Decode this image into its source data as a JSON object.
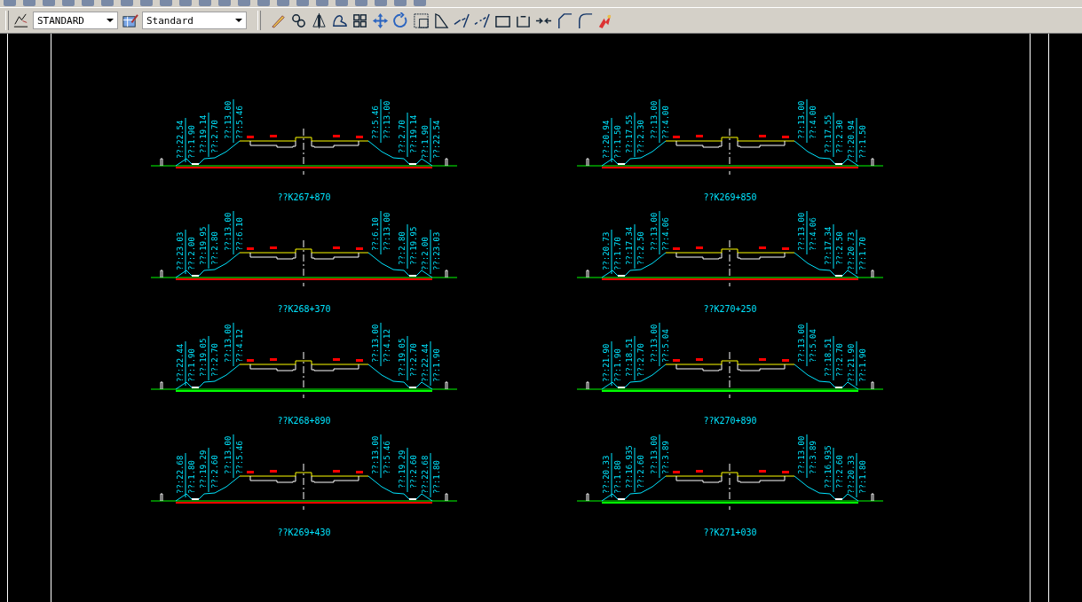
{
  "toolbar": {
    "dropdowns": [
      {
        "value": "STANDARD"
      },
      {
        "value": "Standard"
      }
    ]
  },
  "sections": [
    {
      "station": "??K267+870",
      "color": "#ff0000",
      "left": [
        [
          "??:22.54",
          "??:1.90"
        ],
        [
          "??:19.14",
          "??:2.70"
        ],
        [
          "??:13.00",
          "??:5.46"
        ]
      ],
      "right": [
        [
          "??:5.46",
          "??:13.00"
        ],
        [
          "??:2.70",
          "??:19.14"
        ],
        [
          "??:1.90",
          "??:22.54"
        ]
      ]
    },
    {
      "station": "??K269+850",
      "color": "#ff0000",
      "left": [
        [
          "??:20.94",
          "??:1.50"
        ],
        [
          "??:17.55",
          "??:2.30"
        ],
        [
          "??:13.00",
          "??:4.00"
        ]
      ],
      "right": [
        [
          "??:13.00",
          "??:4.00"
        ],
        [
          "??:17.55",
          "??:2.30"
        ],
        [
          "??:20.94",
          "??:1.50"
        ]
      ]
    },
    {
      "station": "??K268+370",
      "color": "#ff0000",
      "left": [
        [
          "??:23.03",
          "??:2.00"
        ],
        [
          "??:19.95",
          "??:2.80"
        ],
        [
          "??:13.00",
          "??:6.10"
        ]
      ],
      "right": [
        [
          "??:6.10",
          "??:13.00"
        ],
        [
          "??:2.80",
          "??:19.95"
        ],
        [
          "??:2.00",
          "??:23.03"
        ]
      ]
    },
    {
      "station": "??K270+250",
      "color": "#ff0000",
      "left": [
        [
          "??:20.73",
          "??:1.70"
        ],
        [
          "??:17.34",
          "??:2.50"
        ],
        [
          "??:13.00",
          "??:4.06"
        ]
      ],
      "right": [
        [
          "??:13.00",
          "??:4.06"
        ],
        [
          "??:17.34",
          "??:2.50"
        ],
        [
          "??:20.73",
          "??:1.70"
        ]
      ]
    },
    {
      "station": "??K268+890",
      "color": "#00ff00",
      "left": [
        [
          "??:22.44",
          "??:1.90"
        ],
        [
          "??:19.05",
          "??:2.70"
        ],
        [
          "??:13.00",
          "??:4.12"
        ]
      ],
      "right": [
        [
          "??:13.00",
          "??:4.12"
        ],
        [
          "??:19.05",
          "??:2.70"
        ],
        [
          "??:22.44",
          "??:1.90"
        ]
      ]
    },
    {
      "station": "??K270+890",
      "color": "#00ff00",
      "left": [
        [
          "??:21.90",
          "??:1.90"
        ],
        [
          "??:18.51",
          "??:2.70"
        ],
        [
          "??:13.00",
          "??:5.04"
        ]
      ],
      "right": [
        [
          "??:13.00",
          "??:5.04"
        ],
        [
          "??:18.51",
          "??:2.70"
        ],
        [
          "??:21.90",
          "??:1.90"
        ]
      ]
    },
    {
      "station": "??K269+430",
      "color": "#ff0000",
      "left": [
        [
          "??:22.68",
          "??:1.80"
        ],
        [
          "??:19.29",
          "??:2.60"
        ],
        [
          "??:13.00",
          "??:5.46"
        ]
      ],
      "right": [
        [
          "??:13.00",
          "??:5.46"
        ],
        [
          "??:19.29",
          "??:2.60"
        ],
        [
          "??:22.68",
          "??:1.80"
        ]
      ]
    },
    {
      "station": "??K271+030",
      "color": "#00ff00",
      "left": [
        [
          "??:20.33",
          "??:1.80"
        ],
        [
          "??:16.935",
          "??:2.60"
        ],
        [
          "??:13.00",
          "??:3.89"
        ]
      ],
      "right": [
        [
          "??:13.00",
          "??:3.89"
        ],
        [
          "??:16.935",
          "??:2.60"
        ],
        [
          "??:20.33",
          "??:1.80"
        ]
      ]
    }
  ]
}
